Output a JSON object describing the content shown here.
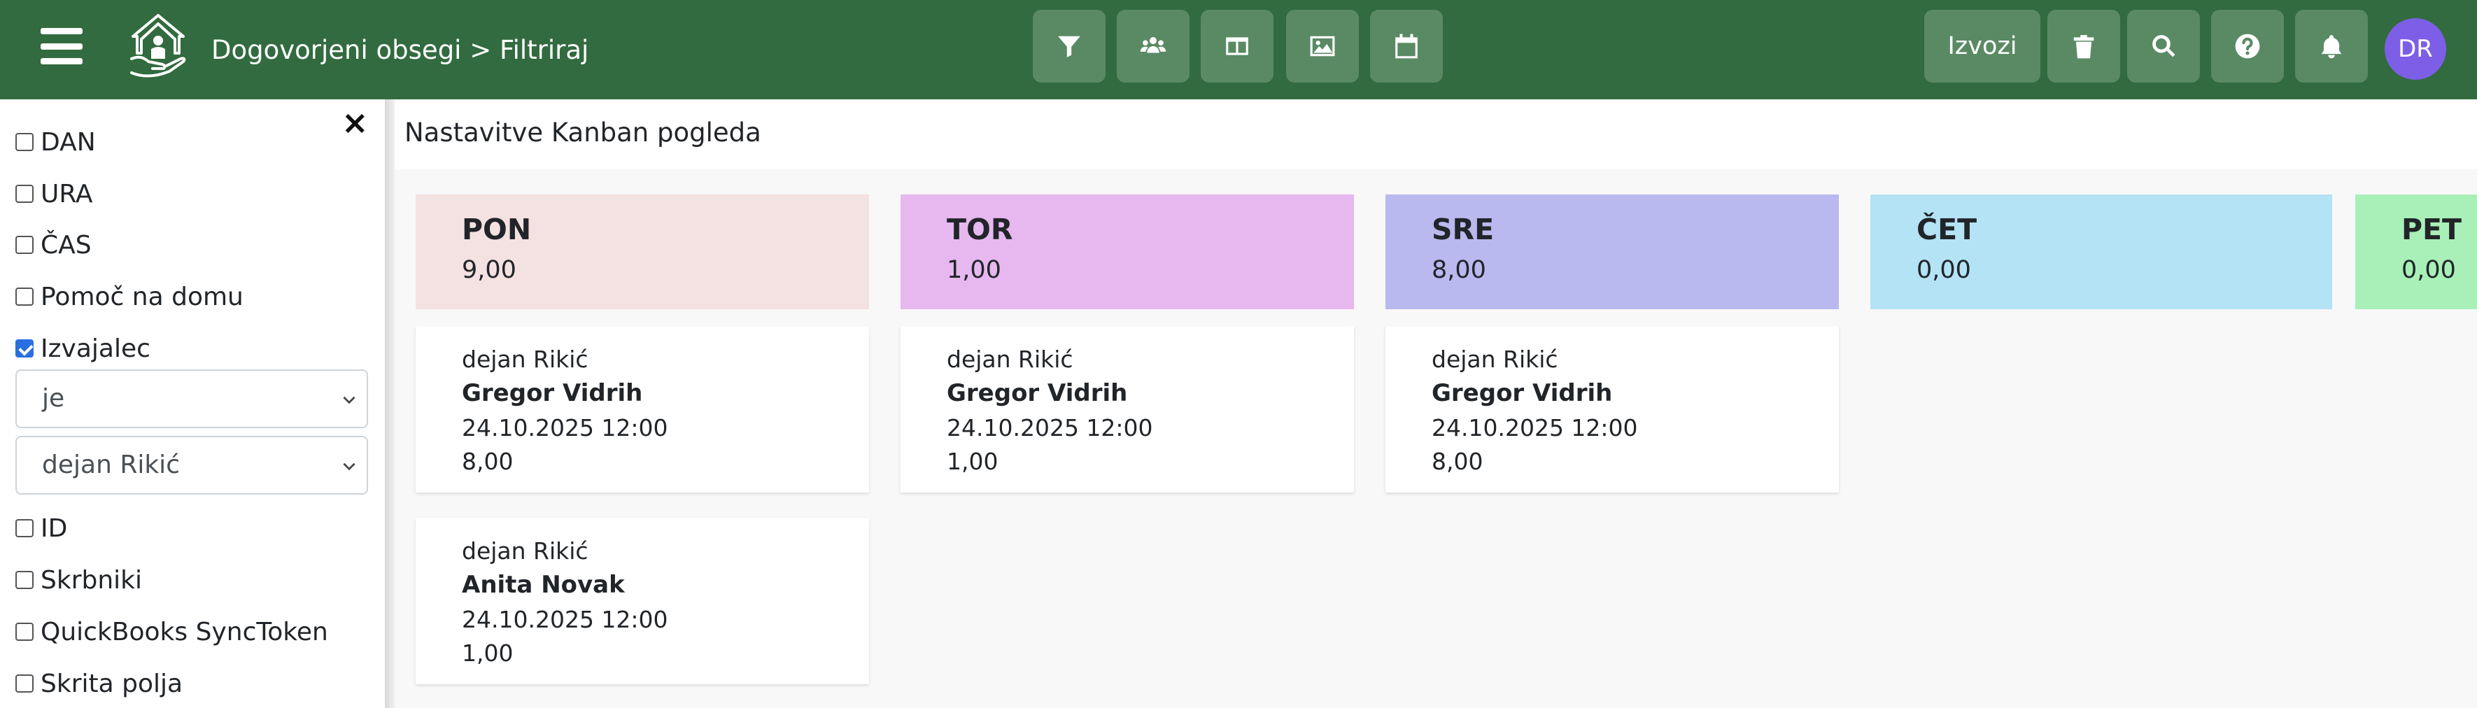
{
  "header": {
    "breadcrumb": "Dogovorjeni obsegi > Filtriraj",
    "export_label": "Izvozi",
    "avatar_initials": "DR",
    "bg_color": "#326b3f",
    "button_color": "#5a8a64",
    "icons": [
      "filter-icon",
      "users-icon",
      "columns-icon",
      "image-icon",
      "calendar-icon",
      "trash-icon",
      "search-icon",
      "help-icon",
      "bell-icon"
    ]
  },
  "sidebar": {
    "fields": [
      {
        "label": "DAN",
        "checked": false
      },
      {
        "label": "URA",
        "checked": false
      },
      {
        "label": "ČAS",
        "checked": false
      },
      {
        "label": "Pomoč na domu",
        "checked": false
      },
      {
        "label": "Izvajalec",
        "checked": true
      },
      {
        "label": "ID",
        "checked": false
      },
      {
        "label": "Skrbniki",
        "checked": false
      },
      {
        "label": "QuickBooks SyncToken",
        "checked": false
      },
      {
        "label": "Skrita polja",
        "checked": false
      }
    ],
    "operator_select": "je",
    "value_select": "dejan Rikić"
  },
  "main": {
    "title": "Nastavitve Kanban pogleda",
    "columns": [
      {
        "day": "PON",
        "total": "9,00",
        "color": "#f4e1e1",
        "cards": [
          {
            "worker": "dejan Rikić",
            "client": "Gregor Vidrih",
            "date": "24.10.2025 12:00",
            "hours": "8,00"
          },
          {
            "worker": "dejan Rikić",
            "client": "Anita Novak",
            "date": "24.10.2025 12:00",
            "hours": "1,00"
          }
        ]
      },
      {
        "day": "TOR",
        "total": "1,00",
        "color": "#e6b8ef",
        "cards": [
          {
            "worker": "dejan Rikić",
            "client": "Gregor Vidrih",
            "date": "24.10.2025 12:00",
            "hours": "1,00"
          }
        ]
      },
      {
        "day": "SRE",
        "total": "8,00",
        "color": "#b9b8ef",
        "cards": [
          {
            "worker": "dejan Rikić",
            "client": "Gregor Vidrih",
            "date": "24.10.2025 12:00",
            "hours": "8,00"
          }
        ]
      },
      {
        "day": "ČET",
        "total": "0,00",
        "color": "#b3e3f4",
        "cards": []
      },
      {
        "day": "PET",
        "total": "0,00",
        "color": "#a8f0b8",
        "cards": []
      }
    ]
  }
}
